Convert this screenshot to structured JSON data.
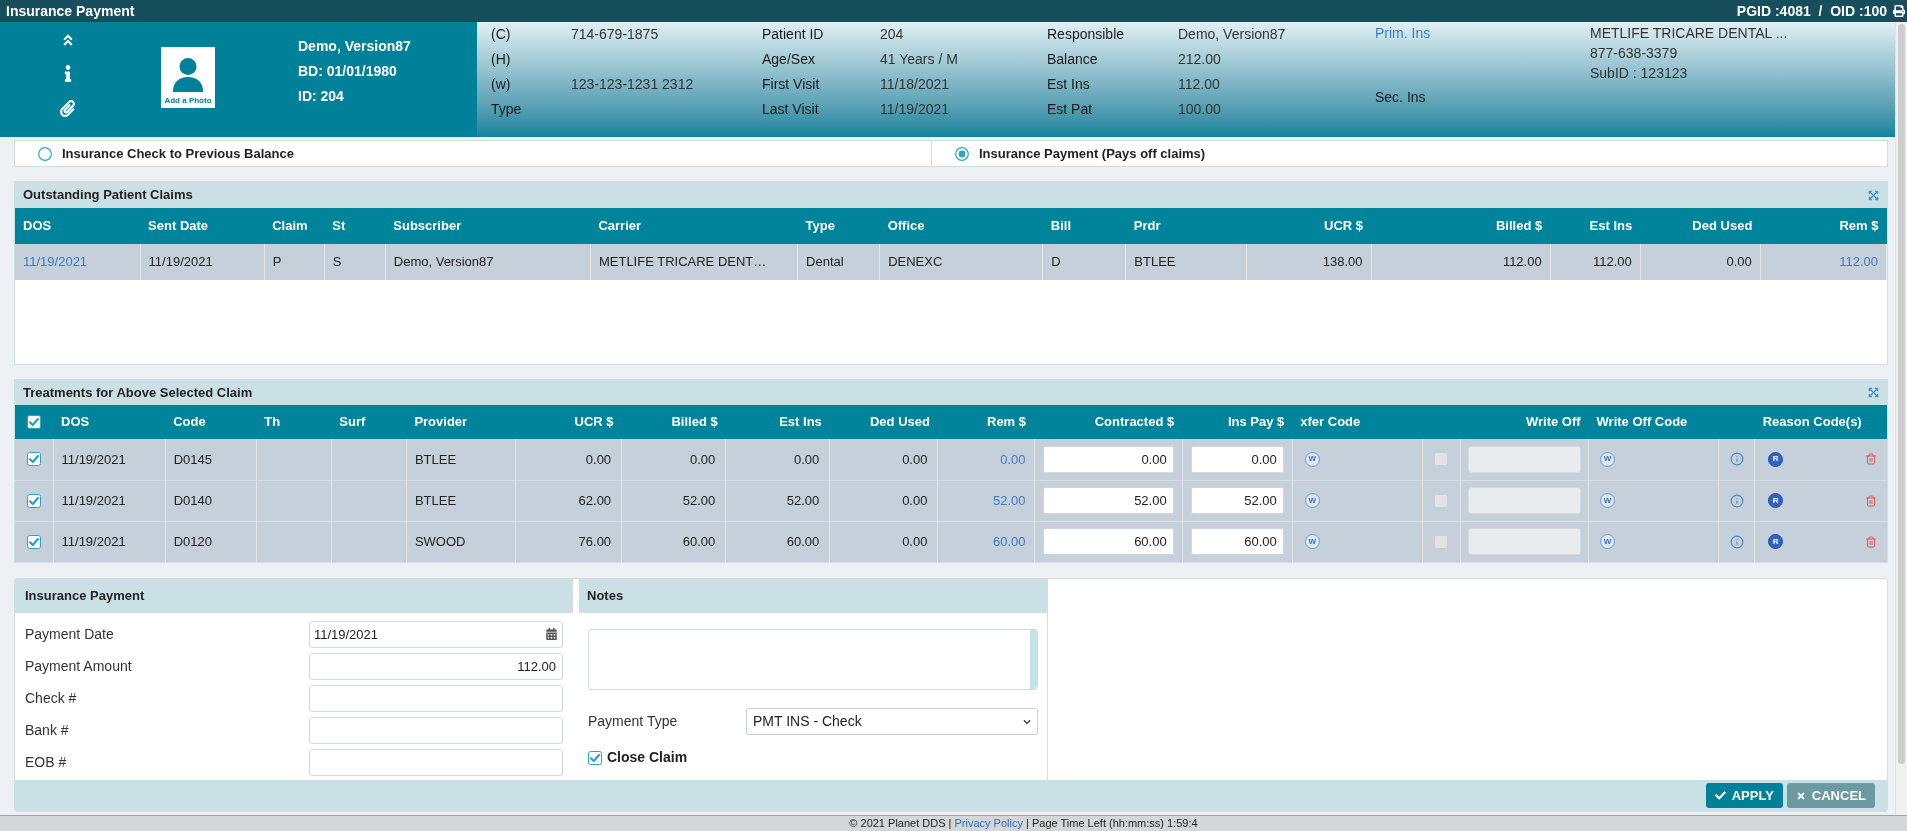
{
  "window": {
    "title": "Insurance Payment",
    "ids": "PGID :4081  /  OID :100"
  },
  "patient": {
    "photo_label": "Add a Photo",
    "name": "Demo, Version87",
    "birth_date": "BD: 01/01/1980",
    "id": "ID: 204"
  },
  "contact": [
    {
      "label": "(C)",
      "value": "714-679-1875"
    },
    {
      "label": "(H)"
    },
    {
      "label": "(w)",
      "value": "123-123-1231 2312"
    },
    {
      "label": "Type"
    }
  ],
  "details": [
    {
      "label": "Patient ID",
      "value": "204"
    },
    {
      "label": "Age/Sex",
      "value": "41 Years / M"
    },
    {
      "label": "First Visit",
      "value": "11/18/2021"
    },
    {
      "label": "Last Visit",
      "value": "11/19/2021"
    }
  ],
  "account": [
    {
      "label": "Responsible",
      "value": "Demo, Version87"
    },
    {
      "label": "Balance",
      "value": "212.00"
    },
    {
      "label": "Est Ins",
      "value": "112.00"
    },
    {
      "label": "Est Pat",
      "value": "100.00"
    }
  ],
  "insurance": [
    {
      "label": "Prim. Ins",
      "kind": "link",
      "lines": [
        "METLIFE TRICARE DENTAL ...",
        "877-638-3379",
        "SubID : 123123"
      ]
    },
    {
      "label": "Sec. Ins",
      "kind": "plain"
    }
  ],
  "payment_modes": [
    {
      "label": "Insurance Check to Previous Balance",
      "selected": false
    },
    {
      "label": "Insurance Payment (Pays off claims)",
      "selected": true
    }
  ],
  "claims": {
    "title": "Outstanding Patient Claims",
    "columns": [
      {
        "label": "DOS",
        "kind": "link"
      },
      {
        "label": "Sent Date",
        "kind": "text"
      },
      {
        "label": "Claim",
        "kind": "text"
      },
      {
        "label": "St",
        "kind": "text"
      },
      {
        "label": "Subscriber",
        "kind": "text"
      },
      {
        "label": "Carrier",
        "kind": "text"
      },
      {
        "label": "Type",
        "kind": "text"
      },
      {
        "label": "Office",
        "kind": "text"
      },
      {
        "label": "Bill",
        "kind": "text"
      },
      {
        "label": "Prdr",
        "kind": "text"
      },
      {
        "label": "UCR $",
        "kind": "amount"
      },
      {
        "label": "Billed $",
        "kind": "amount"
      },
      {
        "label": "Est Ins",
        "kind": "amount"
      },
      {
        "label": "Ded Used",
        "kind": "amount"
      },
      {
        "label": "Rem $",
        "kind": "amount_link"
      }
    ],
    "rows": [
      {
        "cells": [
          "11/19/2021",
          "11/19/2021",
          "P",
          "S",
          "Demo, Version87",
          "METLIFE TRICARE DENT…",
          "Dental",
          "DENEXC",
          "D",
          "BTLEE",
          "138.00",
          "112.00",
          "112.00",
          "0.00",
          "112.00"
        ]
      }
    ]
  },
  "treatments": {
    "title": "Treatments for Above Selected Claim",
    "all_checked": true,
    "columns": [
      "DOS",
      "Code",
      "Th",
      "Surf",
      "Provider",
      "UCR $",
      "Billed $",
      "Est Ins",
      "Ded Used",
      "Rem $",
      "Contracted $",
      "Ins Pay $",
      "xfer Code",
      "Write Off",
      "Write Off Code",
      "Reason Code(s)"
    ],
    "rows": [
      {
        "checked": true,
        "dos": "11/19/2021",
        "code": "D0145",
        "provider": "BTLEE",
        "ucr": "0.00",
        "billed": "0.00",
        "est_ins": "0.00",
        "ded_used": "0.00",
        "rem": "0.00",
        "contracted": "0.00",
        "ins_pay": "0.00",
        "xfer_code": "W",
        "write_off_checked": false,
        "write_off_disabled": true,
        "write_off_code": "W",
        "reason_code": "R"
      },
      {
        "checked": true,
        "dos": "11/19/2021",
        "code": "D0140",
        "provider": "BTLEE",
        "ucr": "62.00",
        "billed": "52.00",
        "est_ins": "52.00",
        "ded_used": "0.00",
        "rem": "52.00",
        "contracted": "52.00",
        "ins_pay": "52.00",
        "xfer_code": "W",
        "write_off_checked": false,
        "write_off_disabled": true,
        "write_off_code": "W",
        "reason_code": "R"
      },
      {
        "checked": true,
        "dos": "11/19/2021",
        "code": "D0120",
        "provider": "SWOOD",
        "ucr": "76.00",
        "billed": "60.00",
        "est_ins": "60.00",
        "ded_used": "0.00",
        "rem": "60.00",
        "contracted": "60.00",
        "ins_pay": "60.00",
        "xfer_code": "W",
        "write_off_checked": false,
        "write_off_disabled": true,
        "write_off_code": "W",
        "reason_code": "R"
      }
    ]
  },
  "insurance_payment": {
    "title": "Insurance Payment",
    "fields": [
      {
        "label": "Payment Date",
        "value": "11/19/2021",
        "kind": "date"
      },
      {
        "label": "Payment Amount",
        "value": "112.00",
        "kind": "amount"
      },
      {
        "label": "Check #",
        "kind": "text"
      },
      {
        "label": "Bank #",
        "kind": "text"
      },
      {
        "label": "EOB #",
        "kind": "text"
      }
    ]
  },
  "notes": {
    "title": "Notes",
    "payment_type": {
      "label": "Payment Type",
      "value": "PMT INS - Check"
    },
    "close_claim": {
      "label": "Close Claim",
      "checked": true
    }
  },
  "actions": [
    {
      "label": "APPLY",
      "kind": "primary"
    },
    {
      "label": "CANCEL",
      "kind": "secondary"
    }
  ],
  "footer": {
    "text_before": "© 2021 Planet DDS |",
    "link": "Privacy Policy",
    "text_after": "| Page Time Left (hh:mm:ss) 1:59:4"
  }
}
